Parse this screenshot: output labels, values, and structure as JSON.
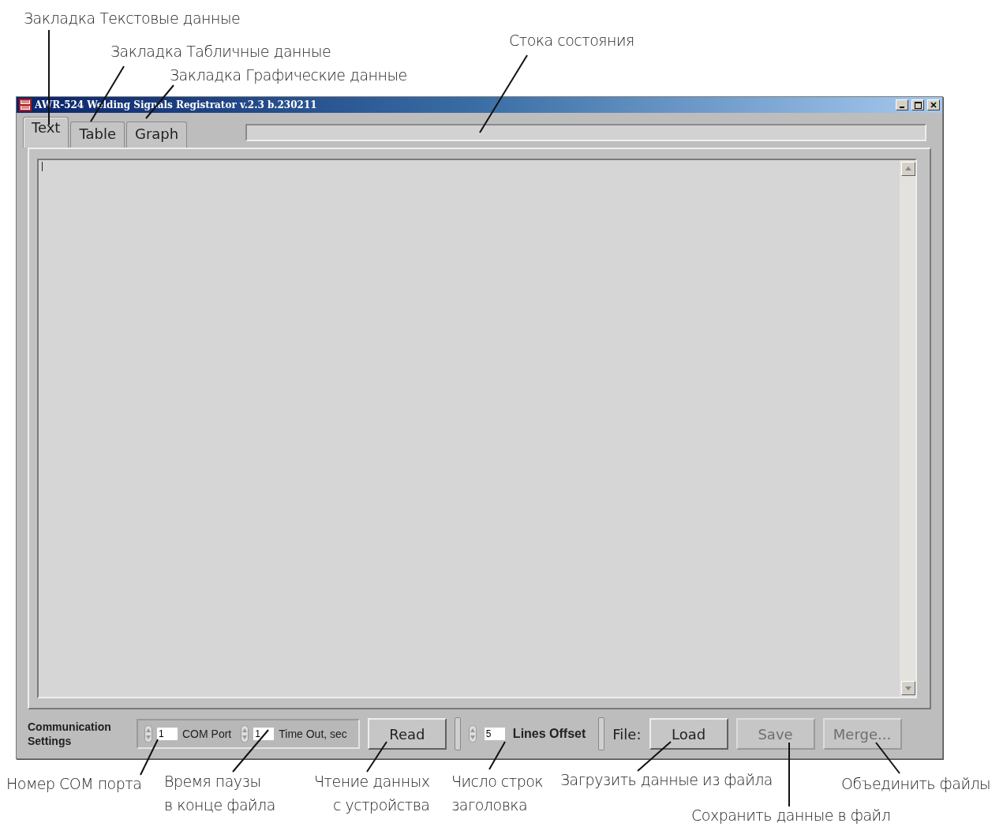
{
  "annotations": [
    {
      "text": "Закладка Текстовые данные"
    },
    {
      "text": "Закладка Табличные данные"
    },
    {
      "text": "Закладка Графические данные"
    },
    {
      "text": "Стока состояния"
    },
    {
      "text": "Номер COM порта"
    },
    {
      "text": "Время паузы\nв конце файла"
    },
    {
      "text": "Чтение данных\nс устройства"
    },
    {
      "text": "Число строк\nзаголовка"
    },
    {
      "text": "Загрузить данные из файла"
    },
    {
      "text": "Сохранить данные в файл"
    },
    {
      "text": "Объединить файлы"
    }
  ],
  "window": {
    "title": "AWR-524 Welding Signals Registrator v.2.3 b.230211",
    "tabs": [
      {
        "label": "Text",
        "selected": true
      },
      {
        "label": "Table",
        "selected": false
      },
      {
        "label": "Graph",
        "selected": false
      }
    ],
    "settings_label": "Communication\nSettings",
    "com_port": {
      "value": "1",
      "label": "COM Port"
    },
    "timeout": {
      "value": "1",
      "label": "Time Out, sec"
    },
    "read_button": {
      "label": "Read",
      "disabled": false
    },
    "lines_offset": {
      "value": "5",
      "label": "Lines Offset"
    },
    "file_label": "File:",
    "file_buttons": [
      {
        "label": "Load",
        "disabled": false
      },
      {
        "label": "Save",
        "disabled": true
      },
      {
        "label": "Merge...",
        "disabled": true
      }
    ]
  }
}
